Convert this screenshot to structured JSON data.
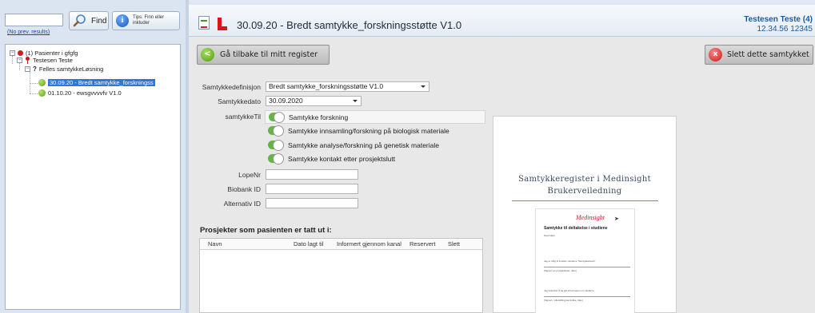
{
  "left_panel": {
    "search_value": "",
    "no_prev_results": "(No prev. results)",
    "find_label": "Find",
    "info_icon": "i",
    "info_tip": "Tips: Finn eller inkluder",
    "tree": {
      "root_label": "(1) Pasienter i gfgfg",
      "patient_label": "Testesen Teste",
      "group_marker": "?",
      "group_label": "Felles samtykkeLøsning",
      "item1_label": "30.09.20 - Bredt samtykke_forskningss",
      "item2_label": "01.10.20 - ewsgvvvvfv V1.0"
    }
  },
  "header": {
    "title": "30.09.20 - Bredt samtykke_forskningsstøtte V1.0",
    "user_name": "Testesen Teste (4)",
    "user_id": "12.34.56 12345"
  },
  "toolbar": {
    "back_label": "Gå tilbake til mitt register",
    "back_icon": "<",
    "delete_label": "Slett dette samtykket",
    "delete_icon": "x"
  },
  "form": {
    "definition_label": "Samtykkedefinisjon",
    "definition_value": "Bredt samtykke_forskningsstøtte V1.0",
    "date_label": "Samtykkedato",
    "date_value": "30.09.2020",
    "samtykke_til_label": "samtykkeTil",
    "toggles": [
      {
        "label": "Samtykke forskning",
        "on": true
      },
      {
        "label": "Samtykke innsamling/forskning på biologisk materiale",
        "on": true
      },
      {
        "label": "Samtykke analyse/forskning på genetisk materiale",
        "on": true
      },
      {
        "label": "Samtykke kontakt etter prosjektslutt",
        "on": true
      }
    ],
    "lopenr_label": "LopeNr",
    "lopenr_value": "",
    "biobank_label": "Biobank ID",
    "biobank_value": "",
    "alternativ_label": "Alternativ ID",
    "alternativ_value": ""
  },
  "projects": {
    "title": "Prosjekter som pasienten er tatt ut i:",
    "columns": [
      "Navn",
      "Dato lagt til",
      "Informert gjennom kanal",
      "Reservert",
      "Slett"
    ]
  },
  "document_preview": {
    "title_line1": "Samtykkeregister i Medinsight",
    "title_line2": "Brukerveiledning",
    "logo_text": "Medinsight",
    "page_heading": "Samtykke til deltakelse i studiene",
    "small_lines": [
      "Navn/dato:",
      "Jeg er villig til å delta i studiene \"Samtykkebevis\"",
      "(Signert av prosjektleder, dato)",
      "Jeg bekrefter å ha gitt informasjon om studiene",
      "(Signert, rolle/stilling/samtykke, dato)"
    ]
  },
  "colors": {
    "accent_red": "#d9141b",
    "toggle_green": "#65b545",
    "selection_blue": "#3075d8",
    "user_blue": "#1d5b9a"
  }
}
